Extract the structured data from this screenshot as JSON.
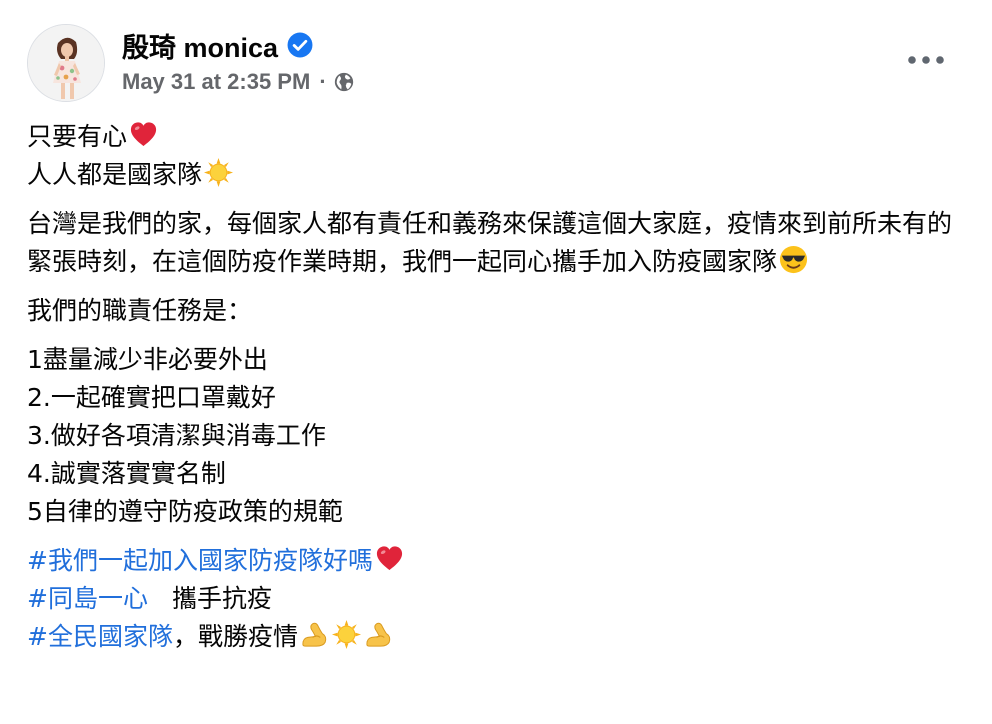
{
  "post": {
    "author": "殷琦 monica",
    "verified_icon": "verified-badge-icon",
    "timestamp": "May 31 at 2:35 PM",
    "separator": "·",
    "audience_icon": "globe-icon",
    "more_icon": "more-options-icon"
  },
  "content": {
    "intro_line1": "只要有心",
    "intro_line2": "人人都是國家隊",
    "paragraph2": "台灣是我們的家，每個家人都有責任和義務來保護這個大家庭，疫情來到前所未有的緊張時刻，在這個防疫作業時期，我們一起同心攜手加入防疫國家隊",
    "duties_heading": "我們的職責任務是：",
    "duties": [
      "1盡量減少非必要外出",
      "2.一起確實把口罩戴好",
      "3.做好各項清潔與消毒工作",
      "4.誠實落實實名制",
      "5自律的遵守防疫政策的規範"
    ],
    "hashtag1": "#我們一起加入國家防疫隊好嗎",
    "hashtag2": "#同島一心",
    "hashtag2_suffix": "攜手抗疫",
    "hashtag3": "#全民國家隊",
    "hashtag3_suffix": "，戰勝疫情"
  },
  "emojis": {
    "heart": "red-heart-emoji",
    "sun": "sun-emoji",
    "sunglasses": "sunglasses-face-emoji",
    "muscle": "flexed-biceps-emoji"
  },
  "colors": {
    "hashtag": "#216fdb",
    "meta": "#65676b",
    "verified": "#1877f2"
  }
}
